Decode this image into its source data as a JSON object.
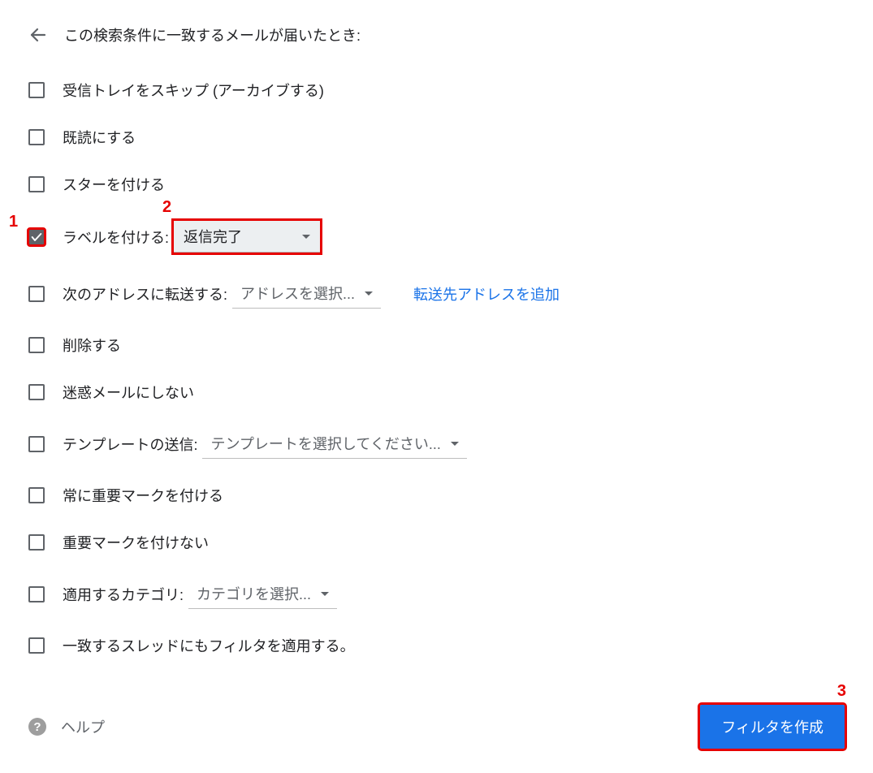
{
  "header": {
    "title": "この検索条件に一致するメールが届いたとき:"
  },
  "options": {
    "skip_inbox": {
      "label": "受信トレイをスキップ (アーカイブする)",
      "checked": false
    },
    "mark_read": {
      "label": "既読にする",
      "checked": false
    },
    "star": {
      "label": "スターを付ける",
      "checked": false
    },
    "apply_label": {
      "label": "ラベルを付ける:",
      "checked": true,
      "selected": "返信完了"
    },
    "forward": {
      "label": "次のアドレスに転送する:",
      "checked": false,
      "selected": "アドレスを選択...",
      "link": "転送先アドレスを追加"
    },
    "delete": {
      "label": "削除する",
      "checked": false
    },
    "never_spam": {
      "label": "迷惑メールにしない",
      "checked": false
    },
    "send_template": {
      "label": "テンプレートの送信:",
      "checked": false,
      "selected": "テンプレートを選択してください..."
    },
    "always_important": {
      "label": "常に重要マークを付ける",
      "checked": false
    },
    "never_important": {
      "label": "重要マークを付けない",
      "checked": false
    },
    "category": {
      "label": "適用するカテゴリ:",
      "checked": false,
      "selected": "カテゴリを選択..."
    },
    "apply_existing": {
      "label": "一致するスレッドにもフィルタを適用する。",
      "checked": false
    }
  },
  "footer": {
    "help": "ヘルプ",
    "create_button": "フィルタを作成"
  },
  "annotations": {
    "n1": "1",
    "n2": "2",
    "n3": "3"
  }
}
